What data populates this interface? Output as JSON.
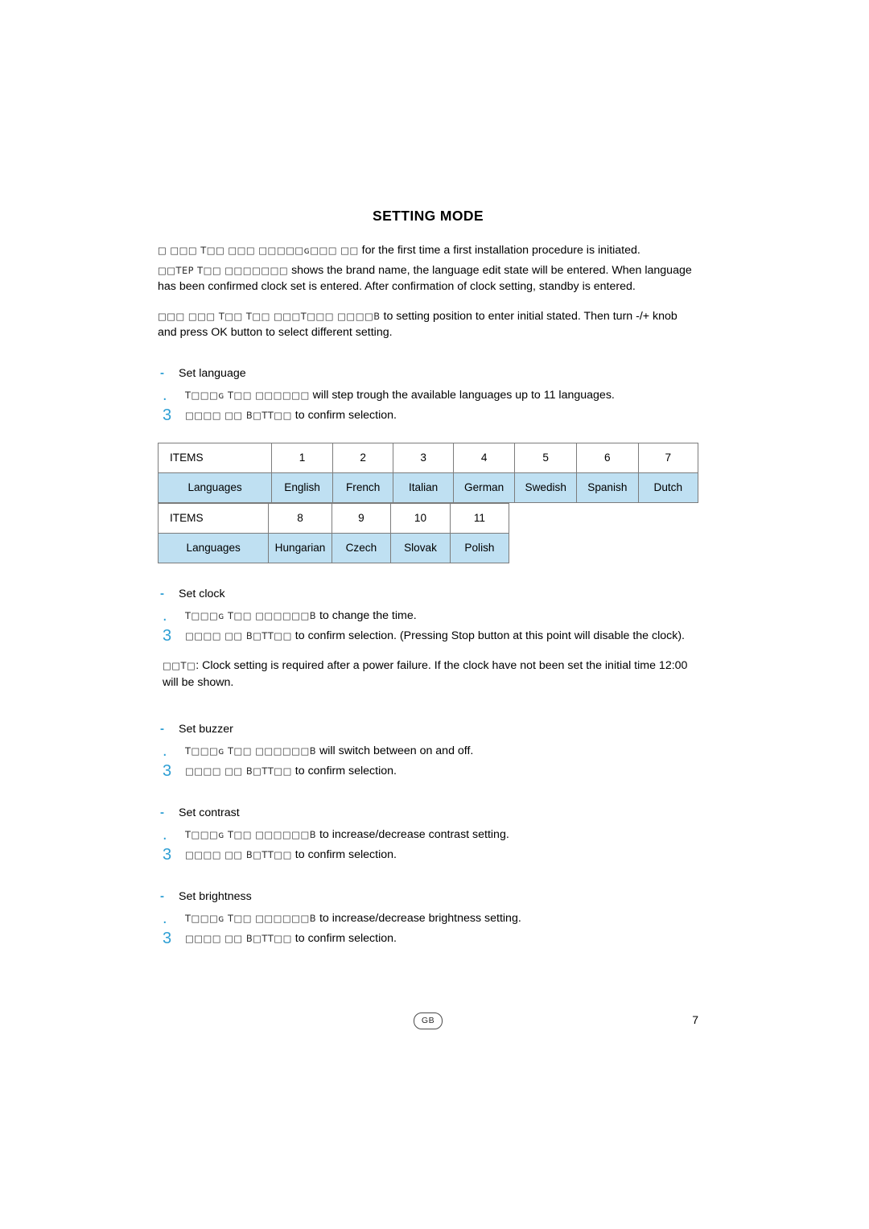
{
  "document": {
    "title": "SETTING MODE",
    "page_number": "7",
    "locale_badge": "GB"
  },
  "intro": {
    "para1_prefix_degraded": "□ □□□ т□□ □□□ □□□□□ɢ□□□ □□",
    "para1_text": "for the first time a first installation procedure is initiated.",
    "para2_prefix_degraded": "□□тер т□□ □□□□□□□",
    "para2_text": "shows the brand name, the language edit state will be entered. When language has been confirmed clock set is entered. After confirmation of clock setting, standby  is entered.",
    "para3_prefix_degraded": "□□□ □□□ т□□ т□□ □□□т□□□ □□□□в",
    "para3_text": "to setting position to enter initial stated.  Then turn -/+ knob and press OK button to select different setting."
  },
  "sections": [
    {
      "marker": "-",
      "label": "Set language",
      "steps": [
        {
          "num": ".",
          "prefix_degraded": "T□□□ɢ  т□□  □□□□□□",
          "text": "will step trough the available languages up to 11 languages."
        },
        {
          "num": "3",
          "prefix_degraded": "□□□□ □□ в□тт□□",
          "text": "to confirm selection."
        }
      ]
    },
    {
      "marker": "-",
      "label": "Set clock",
      "steps": [
        {
          "num": ".",
          "prefix_degraded": "T□□□ɢ  т□□  □□□□□□в",
          "text": "to change the time."
        },
        {
          "num": "3",
          "prefix_degraded": "□□□□ □□ в□тт□□",
          "text": "to confirm selection. (Pressing Stop button at this point will disable the clock)."
        }
      ],
      "note": {
        "prefix_degraded": "□□т□",
        "text": ": Clock setting is required after a power failure. If the clock have not been set the initial time 12:00 will be shown."
      }
    },
    {
      "marker": "-",
      "label": "Set buzzer",
      "steps": [
        {
          "num": ".",
          "prefix_degraded": "T□□□ɢ  т□□  □□□□□□в",
          "text": "will switch between on and off."
        },
        {
          "num": "3",
          "prefix_degraded": "□□□□ □□ в□тт□□",
          "text": "to confirm selection."
        }
      ]
    },
    {
      "marker": "-",
      "label": "Set contrast",
      "steps": [
        {
          "num": ".",
          "prefix_degraded": "T□□□ɢ  т□□  □□□□□□в",
          "text": "to increase/decrease contrast setting."
        },
        {
          "num": "3",
          "prefix_degraded": "□□□□ □□ в□тт□□",
          "text": "to confirm selection."
        }
      ]
    },
    {
      "marker": "-",
      "label": "Set brightness",
      "steps": [
        {
          "num": ".",
          "prefix_degraded": "T□□□ɢ  т□□  □□□□□□в",
          "text": "to increase/decrease brightness setting."
        },
        {
          "num": "3",
          "prefix_degraded": "□□□□ □□ в□тт□□",
          "text": "to confirm selection."
        }
      ]
    }
  ],
  "language_table_1": {
    "header": [
      "ITEMS",
      "1",
      "2",
      "3",
      "4",
      "5",
      "6",
      "7"
    ],
    "values": [
      "Languages",
      "English",
      "French",
      "Italian",
      "German",
      "Swedish",
      "Spanish",
      "Dutch"
    ]
  },
  "language_table_2": {
    "header": [
      "ITEMS",
      "8",
      "9",
      "10",
      "11"
    ],
    "values": [
      "Languages",
      "Hungarian",
      "Czech",
      "Slovak",
      "Polish"
    ]
  },
  "colors": {
    "accent": "#2e9fd4",
    "table_fill": "#bfe0f2",
    "table_border": "#7c7c7c"
  }
}
